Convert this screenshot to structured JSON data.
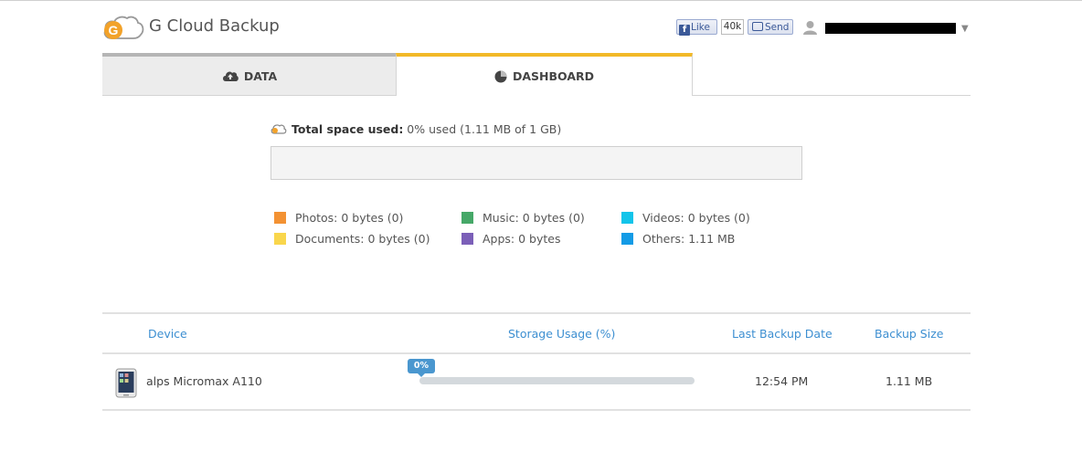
{
  "header": {
    "app_title": "G Cloud Backup",
    "logo_letter": "G",
    "fb_like_label": "Like",
    "fb_like_count": "40k",
    "fb_send_label": "Send",
    "user_menu_caret": "▼"
  },
  "tabs": [
    {
      "label": "DATA",
      "icon": "cloud-upload-icon",
      "active": false
    },
    {
      "label": "DASHBOARD",
      "icon": "pie-chart-icon",
      "active": true
    }
  ],
  "storage": {
    "title": "Total space used:",
    "detail": " 0% used (1.11 MB of 1 GB)",
    "used_fraction": 0.0,
    "legend": [
      {
        "label": "Photos: 0 bytes (0)",
        "color": "#f39233"
      },
      {
        "label": "Documents: 0 bytes (0)",
        "color": "#f9d64c"
      },
      {
        "label": "Music: 0 bytes (0)",
        "color": "#46a868"
      },
      {
        "label": "Apps: 0 bytes",
        "color": "#7b5fb8"
      },
      {
        "label": "Videos: 0 bytes (0)",
        "color": "#12c4ea"
      },
      {
        "label": "Others: 1.11 MB",
        "color": "#139be6"
      }
    ]
  },
  "table": {
    "headers": {
      "device": "Device",
      "usage": "Storage Usage (%)",
      "last_backup": "Last Backup Date",
      "size": "Backup Size"
    },
    "rows": [
      {
        "device": "alps Micromax A110",
        "usage_label": "0%",
        "usage_fraction": 0.0,
        "last_backup": "12:54 PM",
        "size": "1.11 MB"
      }
    ]
  },
  "colors": {
    "accent_tab": "#f2b928",
    "link_blue": "#3d8fd1",
    "logo_orange": "#f2a22a"
  }
}
